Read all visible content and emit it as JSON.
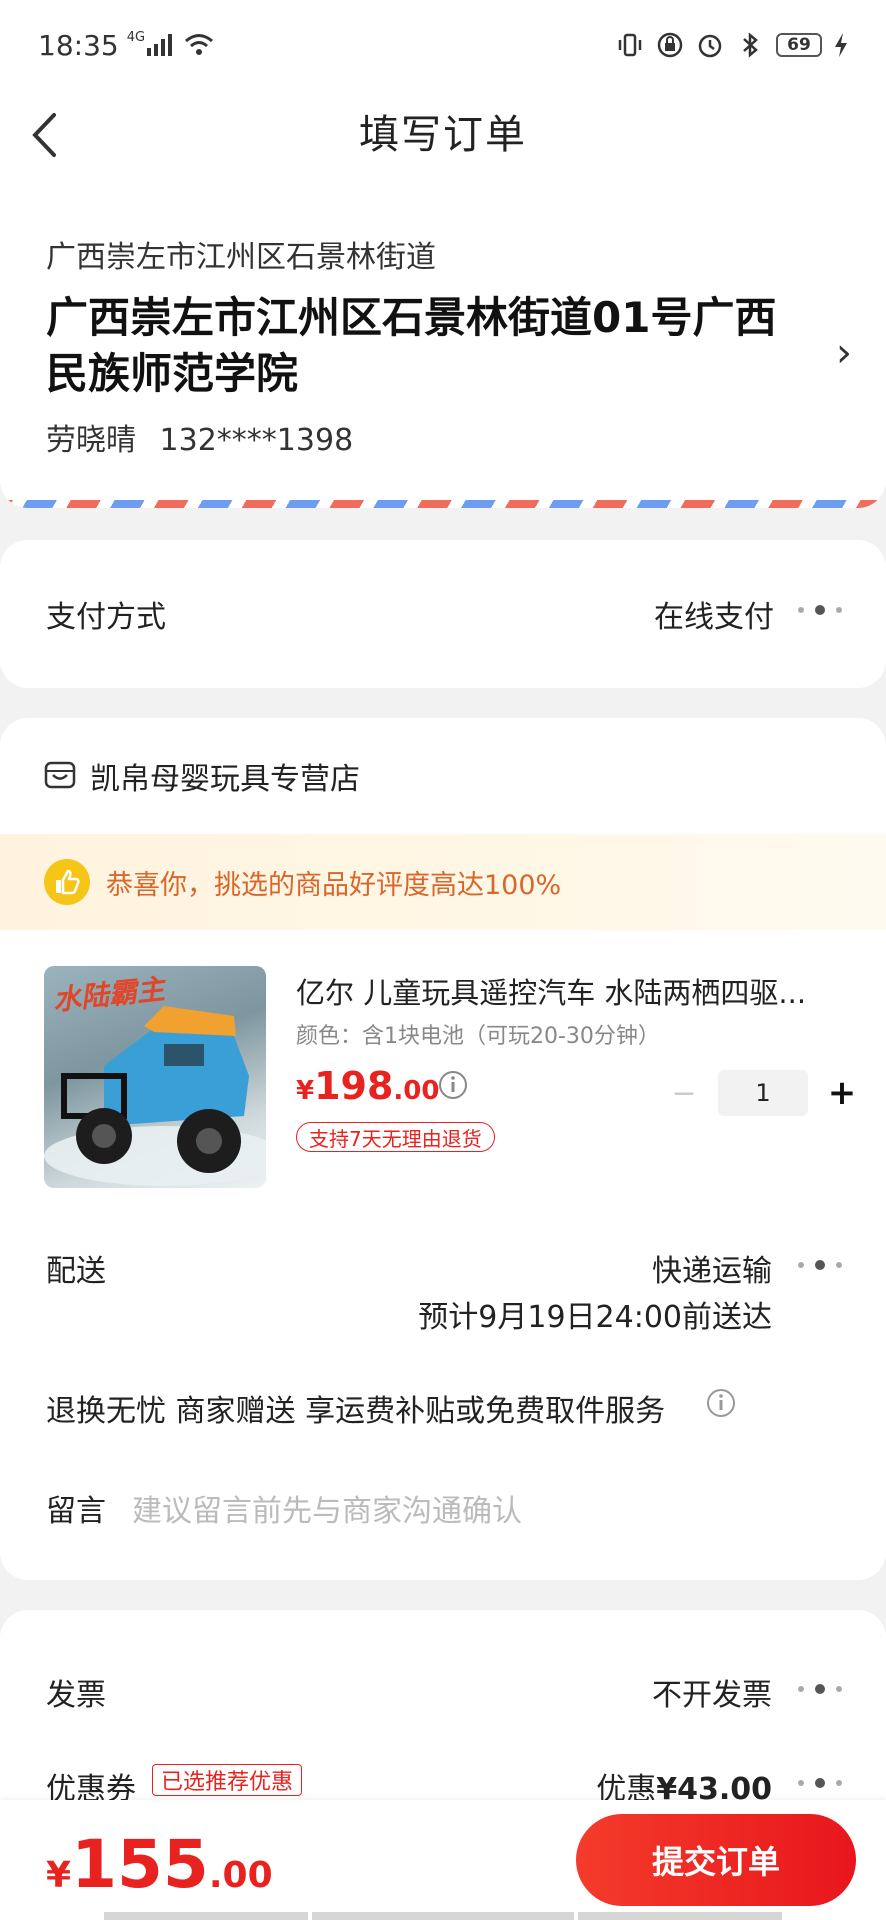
{
  "status_bar": {
    "time": "18:35",
    "network": "4G",
    "battery": "69"
  },
  "nav": {
    "title": "填写订单"
  },
  "address": {
    "region": "广西崇左市江州区石景林街道",
    "detail": "广西崇左市江州区石景林街道01号广西民族师范学院",
    "name": "劳晓晴",
    "phone": "132****1398"
  },
  "payment": {
    "label": "支付方式",
    "value": "在线支付"
  },
  "store": {
    "name": "凯帛母婴玩具专营店",
    "banner": "恭喜你，挑选的商品好评度高达100%"
  },
  "product": {
    "title": "亿尔 儿童玩具遥控汽车 水陆两栖四驱...",
    "spec": "颜色：含1块电池（可玩20-30分钟）",
    "price_currency": "¥",
    "price_int": "198",
    "price_dec": ".00",
    "return_policy": "支持7天无理由退货",
    "quantity": "1",
    "minus": "−",
    "plus": "+",
    "image_text": "水陆霸主"
  },
  "delivery": {
    "label": "配送",
    "method": "快递运输",
    "eta": "预计9月19日24:00前送达"
  },
  "service": {
    "text": "退换无忧 商家赠送  享运费补贴或免费取件服务"
  },
  "message": {
    "label": "留言",
    "placeholder": "建议留言前先与商家沟通确认"
  },
  "invoice": {
    "label": "发票",
    "value": "不开发票"
  },
  "coupon": {
    "label": "优惠券",
    "tag": "已选推荐优惠",
    "value_prefix": "优惠",
    "value": "¥43.00"
  },
  "bottom": {
    "total_currency": "¥",
    "total_int": "155",
    "total_dec": ".00",
    "submit": "提交订单"
  },
  "colors": {
    "accent": "#e8231f",
    "banner_text": "#d9662a"
  }
}
